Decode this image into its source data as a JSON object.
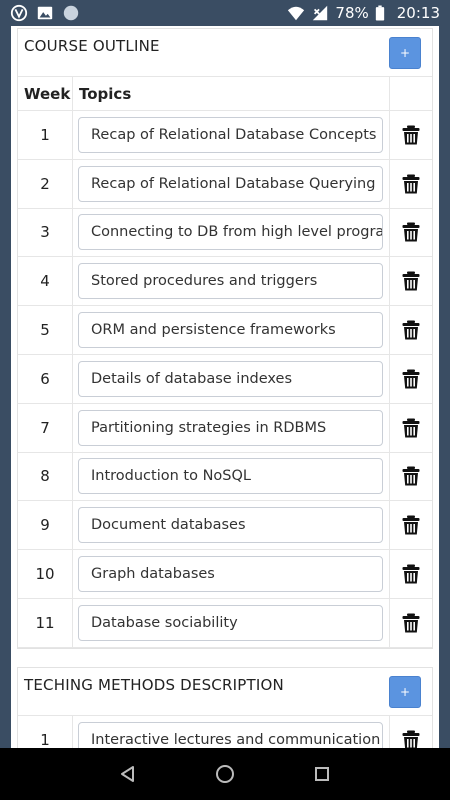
{
  "status": {
    "battery": "78%",
    "time": "20:13",
    "icons": [
      "vpn-icon",
      "image-icon",
      "circle-icon",
      "wifi-icon",
      "signal-icon",
      "battery-icon"
    ]
  },
  "outline": {
    "title": "COURSE OUTLINE",
    "add_label": "+",
    "col_week": "Week",
    "col_topics": "Topics",
    "rows": [
      {
        "week": "1",
        "topic": "Recap of Relational Database Concepts"
      },
      {
        "week": "2",
        "topic": "Recap of Relational Database Querying"
      },
      {
        "week": "3",
        "topic": "Connecting to DB from high level programming"
      },
      {
        "week": "4",
        "topic": "Stored procedures and triggers"
      },
      {
        "week": "5",
        "topic": "ORM and persistence frameworks"
      },
      {
        "week": "6",
        "topic": "Details of database indexes"
      },
      {
        "week": "7",
        "topic": "Partitioning strategies in RDBMS"
      },
      {
        "week": "8",
        "topic": "Introduction to NoSQL"
      },
      {
        "week": "9",
        "topic": "Document databases"
      },
      {
        "week": "10",
        "topic": "Graph databases"
      },
      {
        "week": "11",
        "topic": "Database sociability"
      }
    ]
  },
  "methods": {
    "title": "TECHING METHODS DESCRIPTION",
    "add_label": "+",
    "rows": [
      {
        "week": "1",
        "topic": "Interactive lectures and communication"
      }
    ]
  },
  "colors": {
    "accent": "#5b94e0",
    "statusbar": "#3a4d63"
  }
}
